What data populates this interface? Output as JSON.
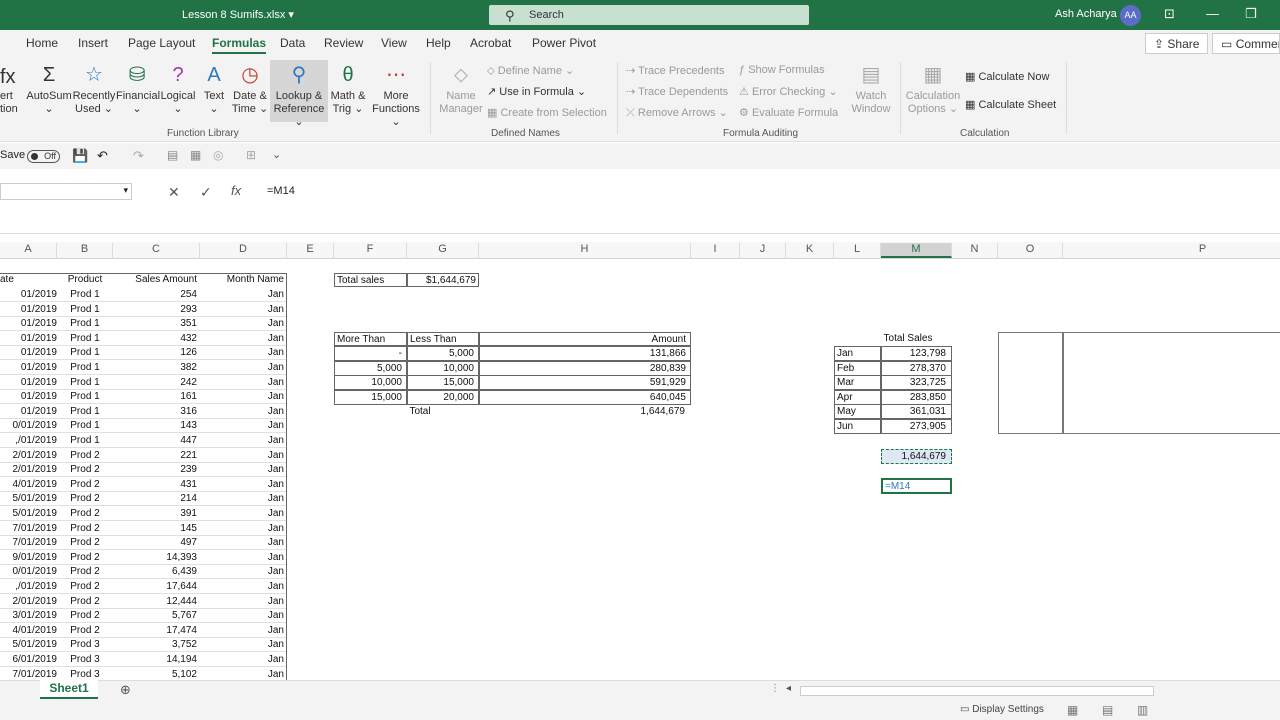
{
  "title_bar": {
    "document": "Lesson 8 Sumifs.xlsx",
    "search_placeholder": "Search",
    "user": "Ash Acharya",
    "initials": "AA"
  },
  "tabs": [
    "Home",
    "Insert",
    "Page Layout",
    "Formulas",
    "Data",
    "Review",
    "View",
    "Help",
    "Acrobat",
    "Power Pivot"
  ],
  "active_tab": "Formulas",
  "share": "Share",
  "comments": "Comments",
  "ribbon": {
    "function_library": {
      "label": "Function Library",
      "insert": [
        "ert",
        "tion"
      ],
      "autosum": "AutoSum",
      "recently": [
        "Recently",
        "Used"
      ],
      "financial": "Financial",
      "logical": "Logical",
      "text": "Text",
      "datetime": [
        "Date &",
        "Time"
      ],
      "lookup": [
        "Lookup &",
        "Reference"
      ],
      "math": [
        "Math &",
        "Trig"
      ],
      "more": [
        "More",
        "Functions"
      ]
    },
    "defined_names": {
      "label": "Defined Names",
      "name_manager": [
        "Name",
        "Manager"
      ],
      "define_name": "Define Name",
      "use_in_formula": "Use in Formula",
      "create_from_selection": "Create from Selection"
    },
    "formula_auditing": {
      "label": "Formula Auditing",
      "trace_precedents": "Trace Precedents",
      "trace_dependents": "Trace Dependents",
      "remove_arrows": "Remove Arrows",
      "show_formulas": "Show Formulas",
      "error_checking": "Error Checking",
      "evaluate_formula": "Evaluate Formula",
      "watch_window": [
        "Watch",
        "Window"
      ]
    },
    "calculation": {
      "label": "Calculation",
      "options": [
        "Calculation",
        "Options"
      ],
      "calc_now": "Calculate Now",
      "calc_sheet": "Calculate Sheet"
    }
  },
  "qat": {
    "autosave": "Save",
    "toggle": "Off"
  },
  "formula_bar": {
    "formula": "=M14"
  },
  "columns": [
    "A",
    "B",
    "C",
    "D",
    "E",
    "F",
    "G",
    "H",
    "I",
    "J",
    "K",
    "L",
    "M",
    "N",
    "O",
    "P"
  ],
  "table": {
    "headers": [
      "ate",
      "Product",
      "Sales Amount",
      "Month Name"
    ],
    "rows": [
      [
        "01/2019",
        "Prod 1",
        "254",
        "Jan"
      ],
      [
        "01/2019",
        "Prod 1",
        "293",
        "Jan"
      ],
      [
        "01/2019",
        "Prod 1",
        "351",
        "Jan"
      ],
      [
        "01/2019",
        "Prod 1",
        "432",
        "Jan"
      ],
      [
        "01/2019",
        "Prod 1",
        "126",
        "Jan"
      ],
      [
        "01/2019",
        "Prod 1",
        "382",
        "Jan"
      ],
      [
        "01/2019",
        "Prod 1",
        "242",
        "Jan"
      ],
      [
        "01/2019",
        "Prod 1",
        "161",
        "Jan"
      ],
      [
        "01/2019",
        "Prod 1",
        "316",
        "Jan"
      ],
      [
        "0/01/2019",
        "Prod 1",
        "143",
        "Jan"
      ],
      [
        ",/01/2019",
        "Prod 1",
        "447",
        "Jan"
      ],
      [
        "2/01/2019",
        "Prod 2",
        "221",
        "Jan"
      ],
      [
        "2/01/2019",
        "Prod 2",
        "239",
        "Jan"
      ],
      [
        "4/01/2019",
        "Prod 2",
        "431",
        "Jan"
      ],
      [
        "5/01/2019",
        "Prod 2",
        "214",
        "Jan"
      ],
      [
        "5/01/2019",
        "Prod 2",
        "391",
        "Jan"
      ],
      [
        "7/01/2019",
        "Prod 2",
        "145",
        "Jan"
      ],
      [
        "7/01/2019",
        "Prod 2",
        "497",
        "Jan"
      ],
      [
        "9/01/2019",
        "Prod 2",
        "14,393",
        "Jan"
      ],
      [
        "0/01/2019",
        "Prod 2",
        "6,439",
        "Jan"
      ],
      [
        ",/01/2019",
        "Prod 2",
        "17,644",
        "Jan"
      ],
      [
        "2/01/2019",
        "Prod 2",
        "12,444",
        "Jan"
      ],
      [
        "3/01/2019",
        "Prod 2",
        "5,767",
        "Jan"
      ],
      [
        "4/01/2019",
        "Prod 2",
        "17,474",
        "Jan"
      ],
      [
        "5/01/2019",
        "Prod 3",
        "3,752",
        "Jan"
      ],
      [
        "6/01/2019",
        "Prod 3",
        "14,194",
        "Jan"
      ],
      [
        "7/01/2019",
        "Prod 3",
        "5,102",
        "Jan"
      ]
    ]
  },
  "total_sales": {
    "label": "Total sales",
    "value": "$1,644,679"
  },
  "range_table": {
    "headers": [
      "More Than",
      "Less Than",
      "Amount"
    ],
    "rows": [
      [
        "-",
        "5,000",
        "131,866"
      ],
      [
        "5,000",
        "10,000",
        "280,839"
      ],
      [
        "10,000",
        "15,000",
        "591,929"
      ],
      [
        "15,000",
        "20,000",
        "640,045"
      ]
    ],
    "total_label": "Total",
    "total": "1,644,679"
  },
  "month_table": {
    "header": "Total Sales",
    "rows": [
      [
        "Jan",
        "123,798"
      ],
      [
        "Feb",
        "278,370"
      ],
      [
        "Mar",
        "323,725"
      ],
      [
        "Apr",
        "283,850"
      ],
      [
        "May",
        "361,031"
      ],
      [
        "Jun",
        "273,905"
      ]
    ],
    "sum": "1,644,679",
    "editing": "=M14"
  },
  "sheet_tab": "Sheet1",
  "status": {
    "display_settings": "Display Settings"
  }
}
